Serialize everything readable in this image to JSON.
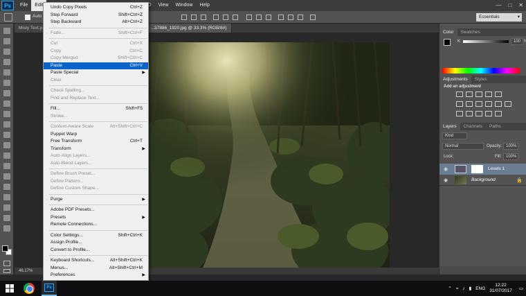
{
  "app": {
    "logo": "Ps"
  },
  "menubar": {
    "items": [
      "File",
      "Edit",
      "Image",
      "Layer",
      "Type",
      "Select",
      "Filter",
      "3D",
      "View",
      "Window",
      "Help"
    ],
    "active": "Edit",
    "window_controls": [
      "—",
      "□",
      "✕"
    ]
  },
  "options": {
    "auto_label": "Auto",
    "workspace": "Essentials"
  },
  "document": {
    "tabs": [
      {
        "label": "Misty Text.p...",
        "active": false
      },
      {
        "label": "...37886_1920.jpg @ 33.3% (RGB/8#)",
        "active": true
      }
    ],
    "zoom": "46.17%"
  },
  "edit_menu": [
    {
      "label": "Undo Copy Pixels",
      "shortcut": "Ctrl+Z",
      "enabled": true
    },
    {
      "label": "Step Forward",
      "shortcut": "Shift+Ctrl+Z",
      "enabled": true
    },
    {
      "label": "Step Backward",
      "shortcut": "Alt+Ctrl+Z",
      "enabled": true
    },
    {
      "sep": true
    },
    {
      "label": "Fade...",
      "shortcut": "Shift+Ctrl+F",
      "enabled": false
    },
    {
      "sep": true
    },
    {
      "label": "Cut",
      "shortcut": "Ctrl+X",
      "enabled": false
    },
    {
      "label": "Copy",
      "shortcut": "Ctrl+C",
      "enabled": false
    },
    {
      "label": "Copy Merged",
      "shortcut": "Shift+Ctrl+C",
      "enabled": false
    },
    {
      "label": "Paste",
      "shortcut": "Ctrl+V",
      "enabled": true,
      "highlighted": true
    },
    {
      "label": "Paste Special",
      "shortcut": "",
      "enabled": true,
      "submenu": true
    },
    {
      "label": "Clear",
      "shortcut": "",
      "enabled": false
    },
    {
      "sep": true
    },
    {
      "label": "Check Spelling...",
      "shortcut": "",
      "enabled": false
    },
    {
      "label": "Find and Replace Text...",
      "shortcut": "",
      "enabled": false
    },
    {
      "sep": true
    },
    {
      "label": "Fill...",
      "shortcut": "Shift+F5",
      "enabled": true
    },
    {
      "label": "Stroke...",
      "shortcut": "",
      "enabled": false
    },
    {
      "sep": true
    },
    {
      "label": "Content-Aware Scale",
      "shortcut": "Alt+Shift+Ctrl+C",
      "enabled": false
    },
    {
      "label": "Puppet Warp",
      "shortcut": "",
      "enabled": true
    },
    {
      "label": "Free Transform",
      "shortcut": "Ctrl+T",
      "enabled": true
    },
    {
      "label": "Transform",
      "shortcut": "",
      "enabled": true,
      "submenu": true
    },
    {
      "label": "Auto-Align Layers...",
      "shortcut": "",
      "enabled": false
    },
    {
      "label": "Auto-Blend Layers...",
      "shortcut": "",
      "enabled": false
    },
    {
      "sep": true
    },
    {
      "label": "Define Brush Preset...",
      "shortcut": "",
      "enabled": false
    },
    {
      "label": "Define Pattern...",
      "shortcut": "",
      "enabled": false
    },
    {
      "label": "Define Custom Shape...",
      "shortcut": "",
      "enabled": false
    },
    {
      "sep": true
    },
    {
      "label": "Purge",
      "shortcut": "",
      "enabled": true,
      "submenu": true
    },
    {
      "sep": true
    },
    {
      "label": "Adobe PDF Presets...",
      "shortcut": "",
      "enabled": true
    },
    {
      "label": "Presets",
      "shortcut": "",
      "enabled": true,
      "submenu": true
    },
    {
      "label": "Remote Connections...",
      "shortcut": "",
      "enabled": true
    },
    {
      "sep": true
    },
    {
      "label": "Color Settings...",
      "shortcut": "Shift+Ctrl+K",
      "enabled": true
    },
    {
      "label": "Assign Profile...",
      "shortcut": "",
      "enabled": true
    },
    {
      "label": "Convert to Profile...",
      "shortcut": "",
      "enabled": true
    },
    {
      "sep": true
    },
    {
      "label": "Keyboard Shortcuts...",
      "shortcut": "Alt+Shift+Ctrl+K",
      "enabled": true
    },
    {
      "label": "Menus...",
      "shortcut": "Alt+Shift+Ctrl+M",
      "enabled": true
    },
    {
      "label": "Preferences",
      "shortcut": "",
      "enabled": true,
      "submenu": true
    }
  ],
  "panels": {
    "color": {
      "tabs": [
        "Color",
        "Swatches"
      ],
      "channel": "K",
      "value": "100",
      "unit": "%"
    },
    "adjustments": {
      "tabs": [
        "Adjustments",
        "Styles"
      ],
      "heading": "Add an adjustment"
    },
    "layers": {
      "tabs": [
        "Layers",
        "Channels",
        "Paths"
      ],
      "kind": "Kind",
      "blend_mode": "Normal",
      "opacity_label": "Opacity:",
      "opacity": "100%",
      "lock_label": "Lock:",
      "fill_label": "Fill:",
      "fill": "100%",
      "rows": [
        {
          "name": "Levels 1",
          "selected": true
        },
        {
          "name": "Background",
          "selected": false
        }
      ]
    }
  },
  "taskbar": {
    "lang": "ENG",
    "time": "12:22",
    "date": "31/07/2017"
  },
  "colors": {
    "highlight": "#0a63c9",
    "ps_blue": "#31a8ff",
    "selected_layer": "#6b7d93"
  }
}
